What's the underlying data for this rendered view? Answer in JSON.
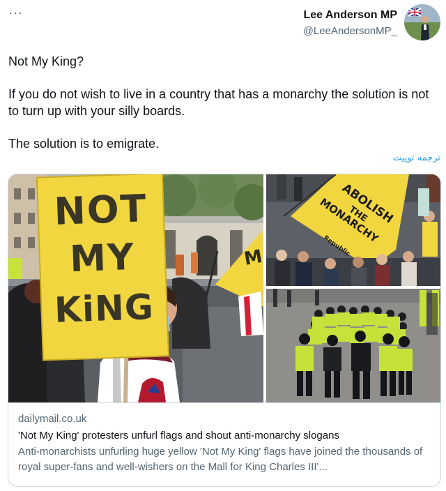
{
  "header": {
    "more_label": "···",
    "display_name": "Lee Anderson MP",
    "handle": "@LeeAndersonMP_"
  },
  "tweet": {
    "lines": [
      "Not My King?",
      "If you do not wish to live in a country that has a monarchy the solution is not to turn up with your silly boards.",
      "The solution is to emigrate."
    ],
    "translate_label": "ترجمه توییت"
  },
  "card": {
    "domain": "dailymail.co.uk",
    "title": "'Not My King' protesters unfurl flags and shout anti-monarchy slogans",
    "description": "Anti-monarchists unfurling huge yellow 'Not My King' flags have joined the thousands of royal super-fans and well-wishers on the Mall for King Charles III'..."
  },
  "images": {
    "sign_text": [
      "NOT",
      "MY",
      "KiNG"
    ],
    "flag_text": [
      "ABOLISH",
      "THE",
      "MONARCHY"
    ],
    "flag_logo": "Republic",
    "side_flag_text": "M"
  },
  "colors": {
    "link_blue": "#1d9bf0",
    "secondary_text": "#536471",
    "protest_yellow": "#f2d640",
    "hi_vis": "#c6e23a"
  }
}
